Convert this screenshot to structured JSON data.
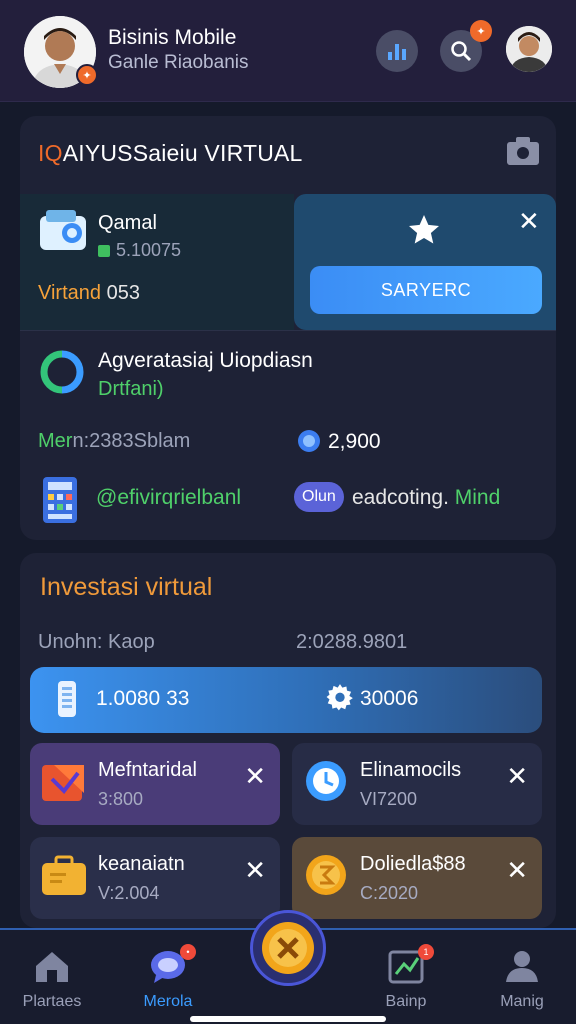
{
  "header": {
    "title": "Bisinis Mobile",
    "subtitle": "Ganle Riaobanis"
  },
  "card_virtual": {
    "title_accent": "IQ",
    "title": "AIYUSSaieiu VIRTUAL",
    "promo": {
      "name": "Qamal",
      "amount": "5.10075",
      "value_label": "Virtand",
      "value": " 053",
      "action_label": "SARYERC"
    },
    "sync_row": {
      "title": "Agveratasiaj Uiopdiasn",
      "subtitle": "Drtfani)"
    },
    "meta": {
      "label_green": "Mer",
      "label": "n:2383Sblam",
      "value": "2,900"
    },
    "link_row": {
      "link": "@efivirqrielbanl",
      "pill": "Olun",
      "text": "eadcoting.",
      "text_green": " Mind"
    }
  },
  "card_invest": {
    "title": "Investasi",
    "title_w": " virtual",
    "left_label": "Unohn: Kaop",
    "right_label": "2:0288.9801",
    "balance": {
      "value": "1.0080 33",
      "value2": "30006"
    },
    "tiles": [
      {
        "name": "Mefntaridal",
        "value": "3:800"
      },
      {
        "name": "Elinamocils",
        "value": "VI7200"
      },
      {
        "name": "keanaiatn",
        "value": "V:2.004"
      },
      {
        "name": "Doliedla$88",
        "value": "C:2020"
      }
    ]
  },
  "nav": {
    "items": [
      {
        "label": "Plartaes"
      },
      {
        "label": "Merola"
      },
      {
        "label": "Bainp"
      },
      {
        "label": "Manig"
      }
    ],
    "badge_nav": "1"
  },
  "colors": {
    "accent_orange": "#ef6a2a",
    "accent_green": "#4fd06a",
    "accent_blue": "#3b9cff",
    "background": "#151a2b"
  }
}
